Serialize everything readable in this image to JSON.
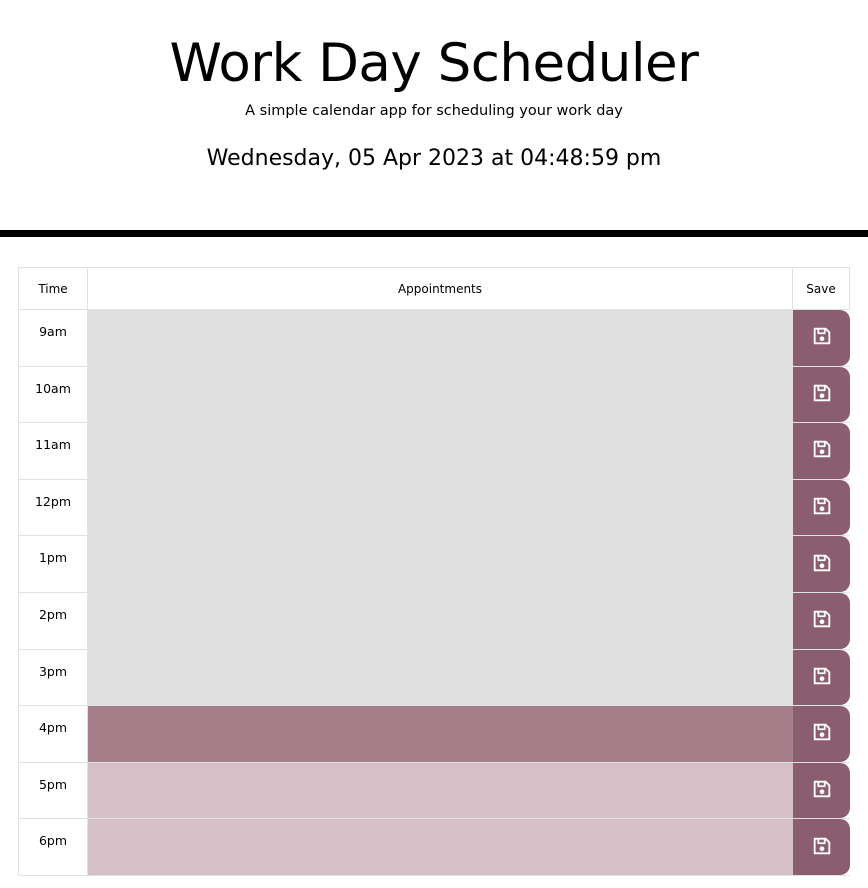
{
  "header": {
    "title": "Work Day Scheduler",
    "subtitle": "A simple calendar app for scheduling your work day",
    "current_day": "Wednesday, 05 Apr 2023 at 04:48:59 pm"
  },
  "table": {
    "columns": [
      "Time",
      "Appointments",
      "Save"
    ],
    "rows": [
      {
        "hour": "9am",
        "state": "past",
        "text": ""
      },
      {
        "hour": "10am",
        "state": "past",
        "text": ""
      },
      {
        "hour": "11am",
        "state": "past",
        "text": ""
      },
      {
        "hour": "12pm",
        "state": "past",
        "text": ""
      },
      {
        "hour": "1pm",
        "state": "past",
        "text": ""
      },
      {
        "hour": "2pm",
        "state": "past",
        "text": ""
      },
      {
        "hour": "3pm",
        "state": "past",
        "text": ""
      },
      {
        "hour": "4pm",
        "state": "present",
        "text": ""
      },
      {
        "hour": "5pm",
        "state": "future",
        "text": ""
      },
      {
        "hour": "6pm",
        "state": "future",
        "text": ""
      }
    ]
  },
  "colors": {
    "past": "#e0e0e0",
    "present": "#a57e8a",
    "future": "#d5c0c7",
    "save_button": "#8a5e6f"
  },
  "icons": {
    "save": "floppy-disk-icon"
  }
}
